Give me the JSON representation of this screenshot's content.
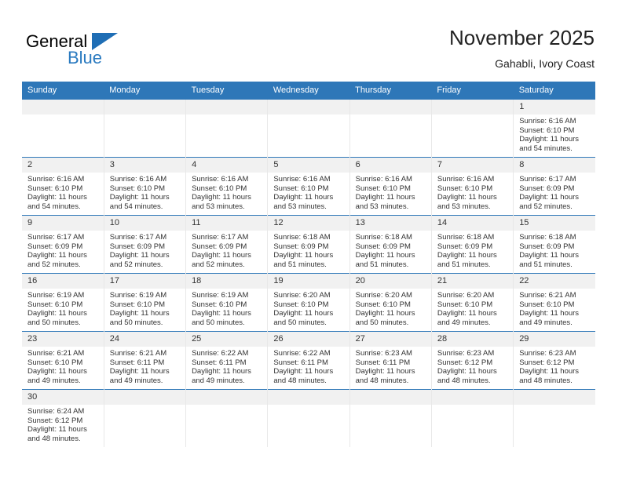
{
  "brand": {
    "name_top": "General",
    "name_bottom": "Blue",
    "accent_color": "#2a7ac0"
  },
  "header": {
    "title": "November 2025",
    "subtitle": "Gahabli, Ivory Coast"
  },
  "theme": {
    "header_blue": "#2e77b8",
    "daynum_band": "#f1f1f1",
    "text": "#333333"
  },
  "weekdays": [
    "Sunday",
    "Monday",
    "Tuesday",
    "Wednesday",
    "Thursday",
    "Friday",
    "Saturday"
  ],
  "labels": {
    "sunrise": "Sunrise:",
    "sunset": "Sunset:",
    "daylight": "Daylight:"
  },
  "weeks": [
    [
      {
        "empty": true
      },
      {
        "empty": true
      },
      {
        "empty": true
      },
      {
        "empty": true
      },
      {
        "empty": true
      },
      {
        "empty": true
      },
      {
        "day": "1",
        "sunrise": "Sunrise: 6:16 AM",
        "sunset": "Sunset: 6:10 PM",
        "daylight_1": "Daylight: 11 hours",
        "daylight_2": "and 54 minutes."
      }
    ],
    [
      {
        "day": "2",
        "sunrise": "Sunrise: 6:16 AM",
        "sunset": "Sunset: 6:10 PM",
        "daylight_1": "Daylight: 11 hours",
        "daylight_2": "and 54 minutes."
      },
      {
        "day": "3",
        "sunrise": "Sunrise: 6:16 AM",
        "sunset": "Sunset: 6:10 PM",
        "daylight_1": "Daylight: 11 hours",
        "daylight_2": "and 54 minutes."
      },
      {
        "day": "4",
        "sunrise": "Sunrise: 6:16 AM",
        "sunset": "Sunset: 6:10 PM",
        "daylight_1": "Daylight: 11 hours",
        "daylight_2": "and 53 minutes."
      },
      {
        "day": "5",
        "sunrise": "Sunrise: 6:16 AM",
        "sunset": "Sunset: 6:10 PM",
        "daylight_1": "Daylight: 11 hours",
        "daylight_2": "and 53 minutes."
      },
      {
        "day": "6",
        "sunrise": "Sunrise: 6:16 AM",
        "sunset": "Sunset: 6:10 PM",
        "daylight_1": "Daylight: 11 hours",
        "daylight_2": "and 53 minutes."
      },
      {
        "day": "7",
        "sunrise": "Sunrise: 6:16 AM",
        "sunset": "Sunset: 6:10 PM",
        "daylight_1": "Daylight: 11 hours",
        "daylight_2": "and 53 minutes."
      },
      {
        "day": "8",
        "sunrise": "Sunrise: 6:17 AM",
        "sunset": "Sunset: 6:09 PM",
        "daylight_1": "Daylight: 11 hours",
        "daylight_2": "and 52 minutes."
      }
    ],
    [
      {
        "day": "9",
        "sunrise": "Sunrise: 6:17 AM",
        "sunset": "Sunset: 6:09 PM",
        "daylight_1": "Daylight: 11 hours",
        "daylight_2": "and 52 minutes."
      },
      {
        "day": "10",
        "sunrise": "Sunrise: 6:17 AM",
        "sunset": "Sunset: 6:09 PM",
        "daylight_1": "Daylight: 11 hours",
        "daylight_2": "and 52 minutes."
      },
      {
        "day": "11",
        "sunrise": "Sunrise: 6:17 AM",
        "sunset": "Sunset: 6:09 PM",
        "daylight_1": "Daylight: 11 hours",
        "daylight_2": "and 52 minutes."
      },
      {
        "day": "12",
        "sunrise": "Sunrise: 6:18 AM",
        "sunset": "Sunset: 6:09 PM",
        "daylight_1": "Daylight: 11 hours",
        "daylight_2": "and 51 minutes."
      },
      {
        "day": "13",
        "sunrise": "Sunrise: 6:18 AM",
        "sunset": "Sunset: 6:09 PM",
        "daylight_1": "Daylight: 11 hours",
        "daylight_2": "and 51 minutes."
      },
      {
        "day": "14",
        "sunrise": "Sunrise: 6:18 AM",
        "sunset": "Sunset: 6:09 PM",
        "daylight_1": "Daylight: 11 hours",
        "daylight_2": "and 51 minutes."
      },
      {
        "day": "15",
        "sunrise": "Sunrise: 6:18 AM",
        "sunset": "Sunset: 6:09 PM",
        "daylight_1": "Daylight: 11 hours",
        "daylight_2": "and 51 minutes."
      }
    ],
    [
      {
        "day": "16",
        "sunrise": "Sunrise: 6:19 AM",
        "sunset": "Sunset: 6:10 PM",
        "daylight_1": "Daylight: 11 hours",
        "daylight_2": "and 50 minutes."
      },
      {
        "day": "17",
        "sunrise": "Sunrise: 6:19 AM",
        "sunset": "Sunset: 6:10 PM",
        "daylight_1": "Daylight: 11 hours",
        "daylight_2": "and 50 minutes."
      },
      {
        "day": "18",
        "sunrise": "Sunrise: 6:19 AM",
        "sunset": "Sunset: 6:10 PM",
        "daylight_1": "Daylight: 11 hours",
        "daylight_2": "and 50 minutes."
      },
      {
        "day": "19",
        "sunrise": "Sunrise: 6:20 AM",
        "sunset": "Sunset: 6:10 PM",
        "daylight_1": "Daylight: 11 hours",
        "daylight_2": "and 50 minutes."
      },
      {
        "day": "20",
        "sunrise": "Sunrise: 6:20 AM",
        "sunset": "Sunset: 6:10 PM",
        "daylight_1": "Daylight: 11 hours",
        "daylight_2": "and 50 minutes."
      },
      {
        "day": "21",
        "sunrise": "Sunrise: 6:20 AM",
        "sunset": "Sunset: 6:10 PM",
        "daylight_1": "Daylight: 11 hours",
        "daylight_2": "and 49 minutes."
      },
      {
        "day": "22",
        "sunrise": "Sunrise: 6:21 AM",
        "sunset": "Sunset: 6:10 PM",
        "daylight_1": "Daylight: 11 hours",
        "daylight_2": "and 49 minutes."
      }
    ],
    [
      {
        "day": "23",
        "sunrise": "Sunrise: 6:21 AM",
        "sunset": "Sunset: 6:10 PM",
        "daylight_1": "Daylight: 11 hours",
        "daylight_2": "and 49 minutes."
      },
      {
        "day": "24",
        "sunrise": "Sunrise: 6:21 AM",
        "sunset": "Sunset: 6:11 PM",
        "daylight_1": "Daylight: 11 hours",
        "daylight_2": "and 49 minutes."
      },
      {
        "day": "25",
        "sunrise": "Sunrise: 6:22 AM",
        "sunset": "Sunset: 6:11 PM",
        "daylight_1": "Daylight: 11 hours",
        "daylight_2": "and 49 minutes."
      },
      {
        "day": "26",
        "sunrise": "Sunrise: 6:22 AM",
        "sunset": "Sunset: 6:11 PM",
        "daylight_1": "Daylight: 11 hours",
        "daylight_2": "and 48 minutes."
      },
      {
        "day": "27",
        "sunrise": "Sunrise: 6:23 AM",
        "sunset": "Sunset: 6:11 PM",
        "daylight_1": "Daylight: 11 hours",
        "daylight_2": "and 48 minutes."
      },
      {
        "day": "28",
        "sunrise": "Sunrise: 6:23 AM",
        "sunset": "Sunset: 6:12 PM",
        "daylight_1": "Daylight: 11 hours",
        "daylight_2": "and 48 minutes."
      },
      {
        "day": "29",
        "sunrise": "Sunrise: 6:23 AM",
        "sunset": "Sunset: 6:12 PM",
        "daylight_1": "Daylight: 11 hours",
        "daylight_2": "and 48 minutes."
      }
    ],
    [
      {
        "day": "30",
        "sunrise": "Sunrise: 6:24 AM",
        "sunset": "Sunset: 6:12 PM",
        "daylight_1": "Daylight: 11 hours",
        "daylight_2": "and 48 minutes."
      },
      {
        "empty": true
      },
      {
        "empty": true
      },
      {
        "empty": true
      },
      {
        "empty": true
      },
      {
        "empty": true
      },
      {
        "empty": true
      }
    ]
  ]
}
